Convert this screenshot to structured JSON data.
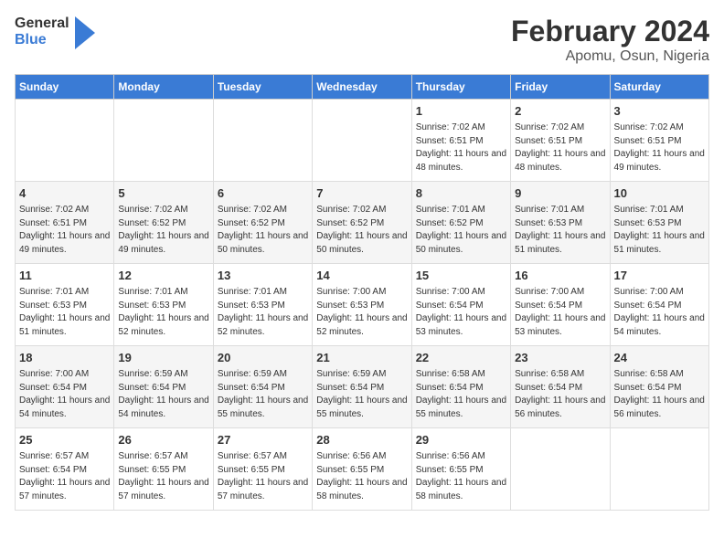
{
  "logo": {
    "text_general": "General",
    "text_blue": "Blue"
  },
  "title": "February 2024",
  "subtitle": "Apomu, Osun, Nigeria",
  "days_of_week": [
    "Sunday",
    "Monday",
    "Tuesday",
    "Wednesday",
    "Thursday",
    "Friday",
    "Saturday"
  ],
  "weeks": [
    [
      {
        "date": "",
        "info": ""
      },
      {
        "date": "",
        "info": ""
      },
      {
        "date": "",
        "info": ""
      },
      {
        "date": "",
        "info": ""
      },
      {
        "date": "1",
        "info": "Sunrise: 7:02 AM\nSunset: 6:51 PM\nDaylight: 11 hours and 48 minutes."
      },
      {
        "date": "2",
        "info": "Sunrise: 7:02 AM\nSunset: 6:51 PM\nDaylight: 11 hours and 48 minutes."
      },
      {
        "date": "3",
        "info": "Sunrise: 7:02 AM\nSunset: 6:51 PM\nDaylight: 11 hours and 49 minutes."
      }
    ],
    [
      {
        "date": "4",
        "info": "Sunrise: 7:02 AM\nSunset: 6:51 PM\nDaylight: 11 hours and 49 minutes."
      },
      {
        "date": "5",
        "info": "Sunrise: 7:02 AM\nSunset: 6:52 PM\nDaylight: 11 hours and 49 minutes."
      },
      {
        "date": "6",
        "info": "Sunrise: 7:02 AM\nSunset: 6:52 PM\nDaylight: 11 hours and 50 minutes."
      },
      {
        "date": "7",
        "info": "Sunrise: 7:02 AM\nSunset: 6:52 PM\nDaylight: 11 hours and 50 minutes."
      },
      {
        "date": "8",
        "info": "Sunrise: 7:01 AM\nSunset: 6:52 PM\nDaylight: 11 hours and 50 minutes."
      },
      {
        "date": "9",
        "info": "Sunrise: 7:01 AM\nSunset: 6:53 PM\nDaylight: 11 hours and 51 minutes."
      },
      {
        "date": "10",
        "info": "Sunrise: 7:01 AM\nSunset: 6:53 PM\nDaylight: 11 hours and 51 minutes."
      }
    ],
    [
      {
        "date": "11",
        "info": "Sunrise: 7:01 AM\nSunset: 6:53 PM\nDaylight: 11 hours and 51 minutes."
      },
      {
        "date": "12",
        "info": "Sunrise: 7:01 AM\nSunset: 6:53 PM\nDaylight: 11 hours and 52 minutes."
      },
      {
        "date": "13",
        "info": "Sunrise: 7:01 AM\nSunset: 6:53 PM\nDaylight: 11 hours and 52 minutes."
      },
      {
        "date": "14",
        "info": "Sunrise: 7:00 AM\nSunset: 6:53 PM\nDaylight: 11 hours and 52 minutes."
      },
      {
        "date": "15",
        "info": "Sunrise: 7:00 AM\nSunset: 6:54 PM\nDaylight: 11 hours and 53 minutes."
      },
      {
        "date": "16",
        "info": "Sunrise: 7:00 AM\nSunset: 6:54 PM\nDaylight: 11 hours and 53 minutes."
      },
      {
        "date": "17",
        "info": "Sunrise: 7:00 AM\nSunset: 6:54 PM\nDaylight: 11 hours and 54 minutes."
      }
    ],
    [
      {
        "date": "18",
        "info": "Sunrise: 7:00 AM\nSunset: 6:54 PM\nDaylight: 11 hours and 54 minutes."
      },
      {
        "date": "19",
        "info": "Sunrise: 6:59 AM\nSunset: 6:54 PM\nDaylight: 11 hours and 54 minutes."
      },
      {
        "date": "20",
        "info": "Sunrise: 6:59 AM\nSunset: 6:54 PM\nDaylight: 11 hours and 55 minutes."
      },
      {
        "date": "21",
        "info": "Sunrise: 6:59 AM\nSunset: 6:54 PM\nDaylight: 11 hours and 55 minutes."
      },
      {
        "date": "22",
        "info": "Sunrise: 6:58 AM\nSunset: 6:54 PM\nDaylight: 11 hours and 55 minutes."
      },
      {
        "date": "23",
        "info": "Sunrise: 6:58 AM\nSunset: 6:54 PM\nDaylight: 11 hours and 56 minutes."
      },
      {
        "date": "24",
        "info": "Sunrise: 6:58 AM\nSunset: 6:54 PM\nDaylight: 11 hours and 56 minutes."
      }
    ],
    [
      {
        "date": "25",
        "info": "Sunrise: 6:57 AM\nSunset: 6:54 PM\nDaylight: 11 hours and 57 minutes."
      },
      {
        "date": "26",
        "info": "Sunrise: 6:57 AM\nSunset: 6:55 PM\nDaylight: 11 hours and 57 minutes."
      },
      {
        "date": "27",
        "info": "Sunrise: 6:57 AM\nSunset: 6:55 PM\nDaylight: 11 hours and 57 minutes."
      },
      {
        "date": "28",
        "info": "Sunrise: 6:56 AM\nSunset: 6:55 PM\nDaylight: 11 hours and 58 minutes."
      },
      {
        "date": "29",
        "info": "Sunrise: 6:56 AM\nSunset: 6:55 PM\nDaylight: 11 hours and 58 minutes."
      },
      {
        "date": "",
        "info": ""
      },
      {
        "date": "",
        "info": ""
      }
    ]
  ]
}
